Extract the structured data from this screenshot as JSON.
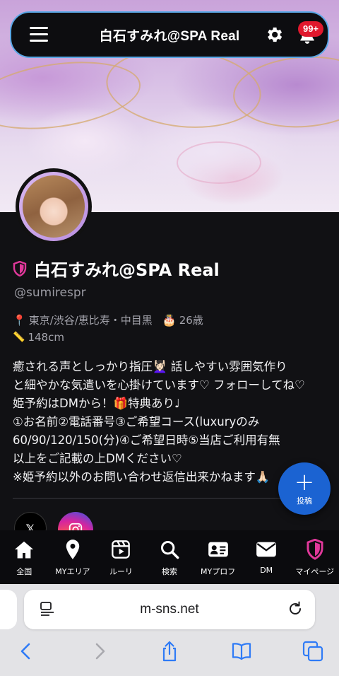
{
  "header": {
    "title": "白石すみれ@SPA Real",
    "notification_badge": "99+"
  },
  "profile": {
    "name": "白石すみれ@SPA Real",
    "handle": "@sumirespr",
    "location": "東京/渋谷/恵比寿・中目黒",
    "age": "26歳",
    "height": "148cm",
    "bio_lines": [
      "癒される声としっかり指圧💆🏻‍♀️ 話しやすい雰囲気作り",
      "と細やかな気遣いを心掛けています♡ フォローしてね♡",
      "姫予約はDMから！🎁特典あり♩",
      "①お名前②電話番号③ご希望コース(luxuryのみ",
      "60/90/120/150(分)④ご希望日時⑤当店ご利用有無",
      "以上をご記載の上DMください♡",
      "※姫予約以外のお問い合わせ返信出来かねます🙏🏻"
    ]
  },
  "fab": {
    "label": "投稿"
  },
  "bottom_nav": {
    "items": [
      {
        "label": "全国",
        "icon": "home-icon"
      },
      {
        "label": "MYエリア",
        "icon": "location-pin-icon"
      },
      {
        "label": "ルーリ",
        "icon": "play-square-icon"
      },
      {
        "label": "検索",
        "icon": "search-icon"
      },
      {
        "label": "MYプロフ",
        "icon": "id-card-icon"
      },
      {
        "label": "DM",
        "icon": "mail-icon"
      },
      {
        "label": "マイページ",
        "icon": "shield-icon"
      }
    ]
  },
  "browser": {
    "url": "m-sns.net"
  },
  "colors": {
    "accent_blue": "#1b63d2",
    "header_border": "#5aa7e6",
    "badge_red": "#e0182d",
    "shield_pink": "#e0389a"
  }
}
